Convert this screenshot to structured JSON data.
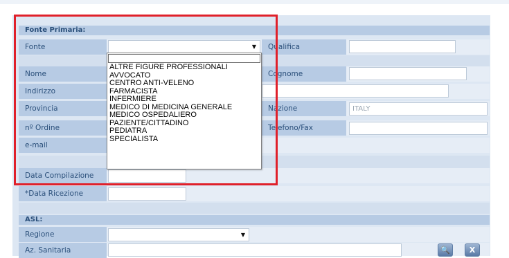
{
  "form": {
    "section_primary": "Fonte Primaria:",
    "fonte_label": "Fonte",
    "qualifica_label": "Qualifica",
    "nome_label": "Nome",
    "cognome_label": "Cognome",
    "indirizzo_label": "Indirizzo",
    "provincia_label": "Provincia",
    "nazione_label": "Nazione",
    "nazione_value": "ITALY",
    "ordine_label": "nº Ordine",
    "telefono_label": "Telefono/Fax",
    "email_label": "e-mail",
    "data_compilazione_label": "Data Compilazione",
    "data_ricezione_label": "*Data Ricezione",
    "section_asl": "ASL:",
    "regione_label": "Regione",
    "azienda_label": "Az. Sanitaria",
    "search_button": "🔍",
    "clear_button": "X"
  },
  "fonte_dropdown": {
    "options": [
      "ALTRE FIGURE PROFESSIONALI",
      "AVVOCATO",
      "CENTRO ANTI-VELENO",
      "FARMACISTA",
      "INFERMIERE",
      "MEDICO DI MEDICINA GENERALE",
      "MEDICO OSPEDALIERO",
      "PAZIENTE/CITTADINO",
      "PEDIATRA",
      "SPECIALISTA"
    ]
  },
  "colors": {
    "highlight": "#e0202a",
    "label_bg": "#b7cbe4",
    "panel_bg": "#dde7f3",
    "label_text": "#2a4f7a"
  }
}
